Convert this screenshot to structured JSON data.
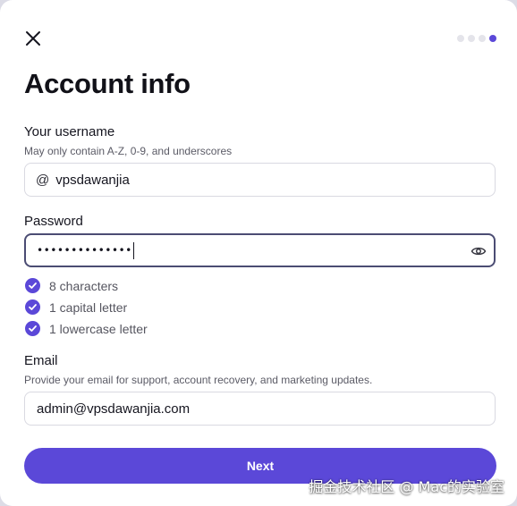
{
  "dialog": {
    "title": "Account info",
    "steps": {
      "total": 4,
      "current": 4
    }
  },
  "username": {
    "label": "Your username",
    "hint": "May only contain A-Z, 0-9, and underscores",
    "prefix": "@",
    "value": "vpsdawanjia"
  },
  "password": {
    "label": "Password",
    "masked_value": "••••••••••••••",
    "requirements": [
      {
        "label": "8 characters",
        "met": true
      },
      {
        "label": "1 capital letter",
        "met": true
      },
      {
        "label": "1 lowercase letter",
        "met": true
      }
    ]
  },
  "email": {
    "label": "Email",
    "hint": "Provide your email for support, account recovery, and marketing updates.",
    "value": "admin@vpsdawanjia.com"
  },
  "actions": {
    "next_label": "Next"
  },
  "watermark": "掘金技术社区 @ Mac的实验室",
  "colors": {
    "accent": "#5b48d8",
    "focus_border": "#4b4c73",
    "border": "#d9d9e1"
  }
}
